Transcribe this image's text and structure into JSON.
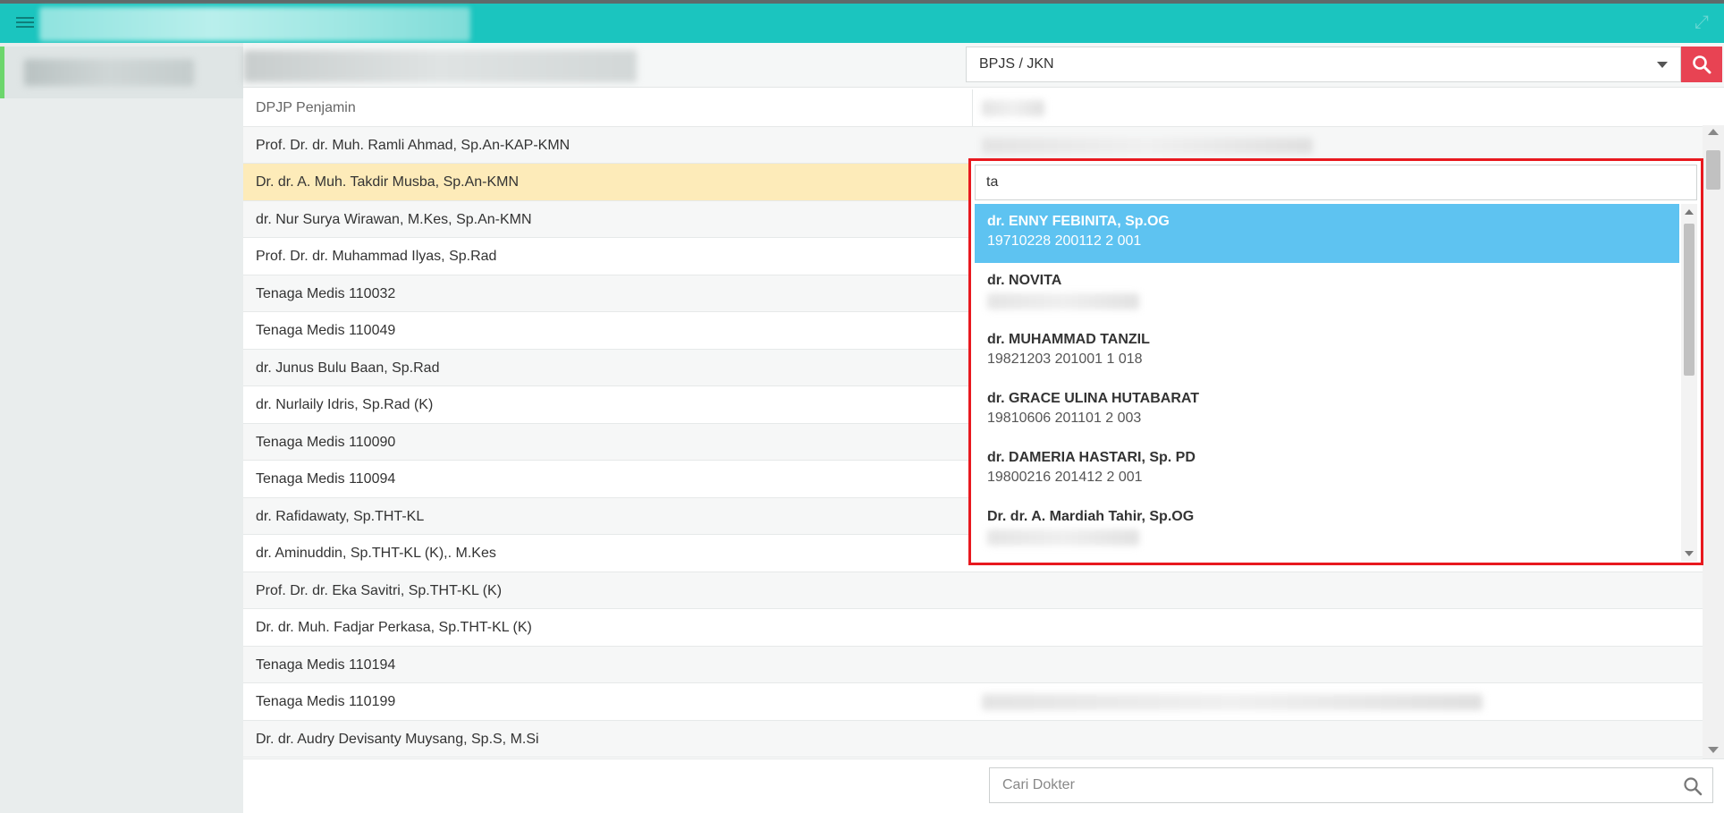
{
  "header": {
    "payer_select": {
      "selected": "BPJS / JKN"
    }
  },
  "table": {
    "column_header": "DPJP Penjamin",
    "rows": [
      {
        "label": "Prof. Dr. dr. Muh. Ramli Ahmad, Sp.An-KAP-KMN"
      },
      {
        "label": "Dr. dr. A. Muh. Takdir Musba, Sp.An-KMN"
      },
      {
        "label": "dr. Nur Surya Wirawan, M.Kes, Sp.An-KMN"
      },
      {
        "label": "Prof. Dr. dr. Muhammad Ilyas, Sp.Rad"
      },
      {
        "label": "Tenaga Medis 110032"
      },
      {
        "label": "Tenaga Medis 110049"
      },
      {
        "label": "dr. Junus Bulu Baan, Sp.Rad"
      },
      {
        "label": "dr. Nurlaily Idris, Sp.Rad (K)"
      },
      {
        "label": "Tenaga Medis 110090"
      },
      {
        "label": "Tenaga Medis 110094"
      },
      {
        "label": "dr. Rafidawaty, Sp.THT-KL"
      },
      {
        "label": "dr. Aminuddin, Sp.THT-KL (K),. M.Kes"
      },
      {
        "label": "Prof. Dr. dr. Eka Savitri, Sp.THT-KL (K)"
      },
      {
        "label": "Dr. dr. Muh. Fadjar Perkasa, Sp.THT-KL (K)"
      },
      {
        "label": "Tenaga Medis 110194"
      },
      {
        "label": "Tenaga Medis 110199"
      },
      {
        "label": "Dr. dr. Audry Devisanty Muysang, Sp.S, M.Si"
      }
    ]
  },
  "dropdown": {
    "query": "ta",
    "options": [
      {
        "name": "dr. ENNY FEBINITA, Sp.OG",
        "nip": "19710228 200112 2 001"
      },
      {
        "name": "dr. NOVITA",
        "nip": ""
      },
      {
        "name": "dr. MUHAMMAD TANZIL",
        "nip": "19821203 201001 1 018"
      },
      {
        "name": "dr. GRACE ULINA HUTABARAT",
        "nip": "19810606 201101 2 003"
      },
      {
        "name": "dr. DAMERIA HASTARI, Sp. PD",
        "nip": "19800216 201412 2 001"
      },
      {
        "name": "Dr. dr. A. Mardiah Tahir, Sp.OG",
        "nip": ""
      }
    ]
  },
  "footer": {
    "search_placeholder": "Cari Dokter"
  },
  "icons": {
    "menu": "menu-icon",
    "expand": "expand-icon",
    "search": "search-icon"
  },
  "colors": {
    "topbar": "#1bc5bf",
    "search_button": "#e84353",
    "selected_row": "#fdebb9",
    "active_option": "#5ec3f1",
    "highlight_border": "#e8191f"
  }
}
